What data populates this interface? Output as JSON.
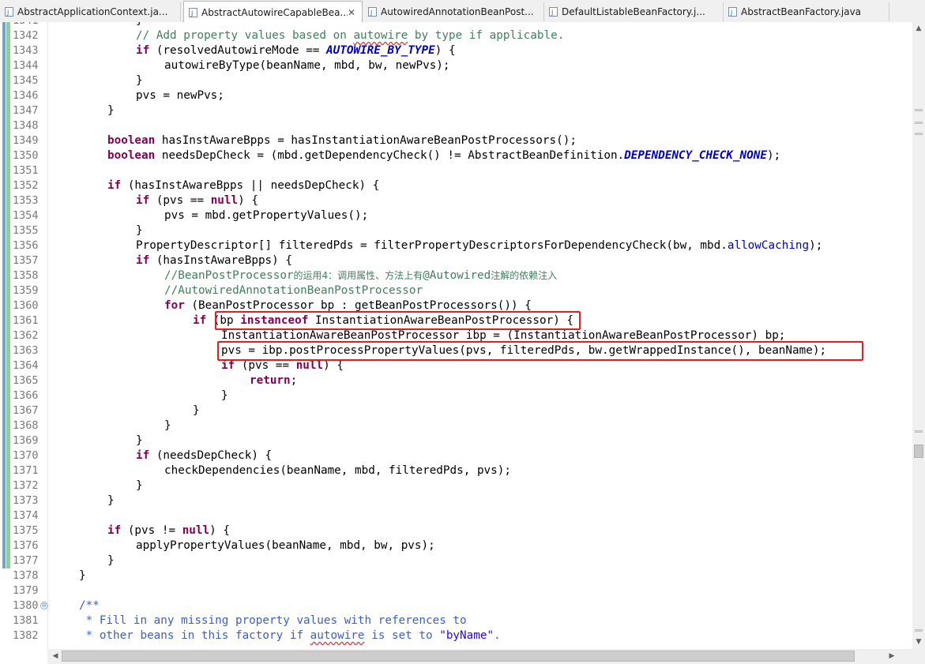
{
  "tabs": [
    {
      "label": "AbstractApplicationContext.ja...",
      "active": false,
      "icon": "java-file-icon"
    },
    {
      "label": "AbstractAutowireCapableBea...",
      "active": true,
      "icon": "java-file-icon",
      "close": "✕"
    },
    {
      "label": "AutowiredAnnotationBeanPost...",
      "active": false,
      "icon": "java-file-icon"
    },
    {
      "label": "DefaultListableBeanFactory.j...",
      "active": false,
      "icon": "java-file-icon"
    },
    {
      "label": "AbstractBeanFactory.java",
      "active": false,
      "icon": "java-file-icon"
    }
  ],
  "editor": {
    "first_line_partial": "1341",
    "lines": [
      {
        "n": "1342"
      },
      {
        "n": "1343"
      },
      {
        "n": "1344"
      },
      {
        "n": "1345"
      },
      {
        "n": "1346"
      },
      {
        "n": "1347"
      },
      {
        "n": "1348"
      },
      {
        "n": "1349"
      },
      {
        "n": "1350"
      },
      {
        "n": "1351"
      },
      {
        "n": "1352"
      },
      {
        "n": "1353"
      },
      {
        "n": "1354"
      },
      {
        "n": "1355"
      },
      {
        "n": "1356"
      },
      {
        "n": "1357"
      },
      {
        "n": "1358"
      },
      {
        "n": "1359"
      },
      {
        "n": "1360"
      },
      {
        "n": "1361"
      },
      {
        "n": "1362"
      },
      {
        "n": "1363"
      },
      {
        "n": "1364"
      },
      {
        "n": "1365"
      },
      {
        "n": "1366"
      },
      {
        "n": "1367"
      },
      {
        "n": "1368"
      },
      {
        "n": "1369"
      },
      {
        "n": "1370"
      },
      {
        "n": "1371"
      },
      {
        "n": "1372"
      },
      {
        "n": "1373"
      },
      {
        "n": "1374"
      },
      {
        "n": "1375"
      },
      {
        "n": "1376"
      },
      {
        "n": "1377"
      },
      {
        "n": "1378"
      },
      {
        "n": "1379"
      },
      {
        "n": "1380"
      },
      {
        "n": "1381"
      },
      {
        "n": "1382"
      }
    ],
    "fold_marker": "⊖",
    "code": {
      "l1342": [
        "// Add property values based on ",
        "autowire",
        " by type if applicable."
      ],
      "l1343": [
        "if",
        " (resolvedAutowireMode == ",
        "AUTOWIRE_BY_TYPE",
        ") {"
      ],
      "l1344": [
        "autowireByType(beanName, mbd, bw, newPvs);"
      ],
      "l1345": [
        "}"
      ],
      "l1346": [
        "pvs = newPvs;"
      ],
      "l1347": [
        "}"
      ],
      "l1349": [
        "boolean",
        " hasInstAwareBpps = hasInstantiationAwareBeanPostProcessors();"
      ],
      "l1350": [
        "boolean",
        " needsDepCheck = (mbd.getDependencyCheck() != AbstractBeanDefinition.",
        "DEPENDENCY_CHECK_NONE",
        ");"
      ],
      "l1352": [
        "if",
        " (hasInstAwareBpps || needsDepCheck) {"
      ],
      "l1353": [
        "if",
        " (pvs == ",
        "null",
        ") {"
      ],
      "l1354": [
        "pvs = mbd.getPropertyValues();"
      ],
      "l1355": [
        "}"
      ],
      "l1356": [
        "PropertyDescriptor[] filteredPds = filterPropertyDescriptorsForDependencyCheck(bw, mbd.",
        "allowCaching",
        ");"
      ],
      "l1357": [
        "if",
        " (hasInstAwareBpps) {"
      ],
      "l1358": [
        "//BeanPostProcessor",
        "的运用4：调用属性、方法上有",
        "@Autowired",
        "注解的依赖注入"
      ],
      "l1359": [
        "//AutowiredAnnotationBeanPostProcessor"
      ],
      "l1360": [
        "for",
        " (BeanPostProcessor bp : getBeanPostProcessors()) {"
      ],
      "l1361": [
        "if",
        " (bp ",
        "instanceof",
        " InstantiationAwareBeanPostProcessor) {"
      ],
      "l1362": [
        "InstantiationAwareBeanPostProcessor ibp = (InstantiationAwareBeanPostProcessor) bp;"
      ],
      "l1363": [
        "pvs = ibp.postProcessPropertyValues(pvs, filteredPds, bw.getWrappedInstance(), beanName);"
      ],
      "l1364": [
        "if",
        " (pvs == ",
        "null",
        ") {"
      ],
      "l1365": [
        "return",
        ";"
      ],
      "l1366": [
        "}"
      ],
      "l1367": [
        "}"
      ],
      "l1368": [
        "}"
      ],
      "l1369": [
        "}"
      ],
      "l1370": [
        "if",
        " (needsDepCheck) {"
      ],
      "l1371": [
        "checkDependencies(beanName, mbd, filteredPds, pvs);"
      ],
      "l1372": [
        "}"
      ],
      "l1373": [
        "}"
      ],
      "l1375": [
        "if",
        " (pvs != ",
        "null",
        ") {"
      ],
      "l1376": [
        "applyPropertyValues(beanName, mbd, bw, pvs);"
      ],
      "l1377": [
        "}"
      ],
      "l1378": [
        "}"
      ],
      "l1380": [
        "/**"
      ],
      "l1381": [
        " * Fill in any missing property values with references to"
      ],
      "l1382": [
        " * other beans in this factory if ",
        "autowire",
        " is set to ",
        "\"byName\"",
        "."
      ]
    }
  },
  "scrollbars": {
    "up_arrow": "▲",
    "down_arrow": "▼",
    "left_arrow": "◀",
    "right_arrow": "▶"
  },
  "colors": {
    "keyword": "#7f0055",
    "comment": "#3f7f5f",
    "javadoc": "#3f5fbf",
    "static_field": "#0000c0",
    "highlight_box": "#e02020"
  }
}
